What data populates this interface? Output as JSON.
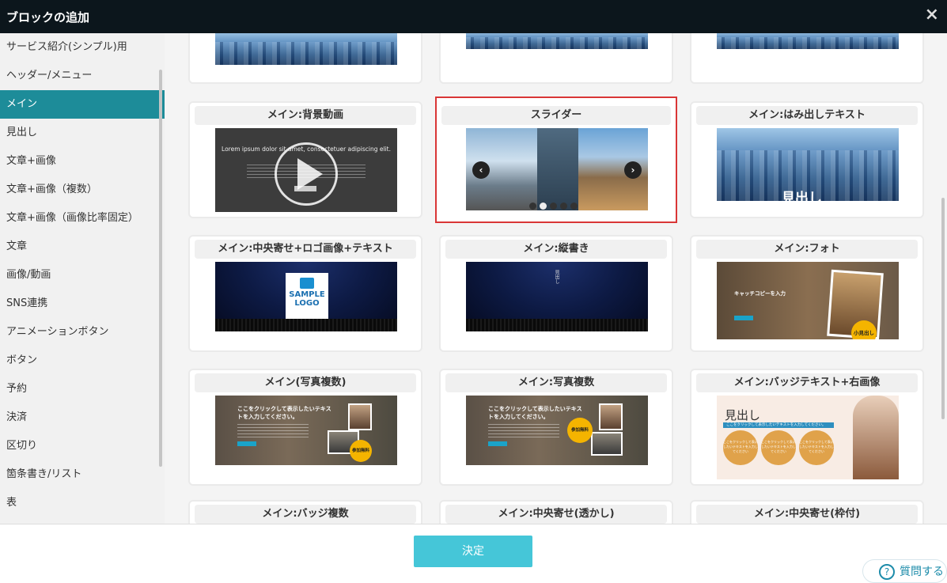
{
  "dialog": {
    "title": "ブロックの追加",
    "close_icon": "×"
  },
  "sidebar": {
    "items": [
      {
        "label": "サービス紹介(シンプル)用"
      },
      {
        "label": "ヘッダー/メニュー"
      },
      {
        "label": "メイン",
        "active": true
      },
      {
        "label": "見出し"
      },
      {
        "label": "文章+画像"
      },
      {
        "label": "文章+画像（複数）"
      },
      {
        "label": "文章+画像（画像比率固定）"
      },
      {
        "label": "文章"
      },
      {
        "label": "画像/動画"
      },
      {
        "label": "SNS連携"
      },
      {
        "label": "アニメーションボタン"
      },
      {
        "label": "ボタン"
      },
      {
        "label": "予約"
      },
      {
        "label": "決済"
      },
      {
        "label": "区切り"
      },
      {
        "label": "箇条書き/リスト"
      },
      {
        "label": "表"
      }
    ]
  },
  "cards": {
    "video": {
      "label": "メイン:背景動画",
      "lorem": "Lorem ipsum dolor sit amet, consectetuer adipiscing elit."
    },
    "slider": {
      "label": "スライダー",
      "prev": "‹",
      "next": "›",
      "slides": 5,
      "current": 2
    },
    "overhang": {
      "label": "メイン:はみ出しテキスト",
      "overlay": "見出し"
    },
    "center_logo": {
      "label": "メイン:中央寄せ+ロゴ画像+テキスト",
      "logo_line1": "SAMPLE",
      "logo_line2": "LOGO"
    },
    "vertical": {
      "label": "メイン:縦書き",
      "vtext": "見出し"
    },
    "photo": {
      "label": "メイン:フォト",
      "copy": "キャッチコピーを入力",
      "badge": "小見出し"
    },
    "multi1": {
      "label": "メイン(写真複数)",
      "heading": "ここをクリックして表示したいテキストを入力してください。",
      "badge": "参加無料"
    },
    "multi2": {
      "label": "メイン:写真複数",
      "heading": "ここをクリックして表示したいテキストを入力してください。",
      "badge": "参加無料"
    },
    "badge_text": {
      "label": "メイン:バッジテキスト+右画像",
      "heading": "見出し",
      "bar": "ここをクリックして表示したいテキストを入力してください。",
      "circle": "ここをクリックして表示したいテキストを入力してください"
    },
    "badge_multi": {
      "label": "メイン:バッジ複数"
    },
    "center_watermark": {
      "label": "メイン:中央寄せ(透かし)"
    },
    "center_framed": {
      "label": "メイン:中央寄せ(枠付)"
    }
  },
  "footer": {
    "decide_label": "決定",
    "help_label": "質問する",
    "help_icon": "?"
  },
  "colors": {
    "titlebar": "#0c161c",
    "active": "#1d8c99",
    "decide": "#45c6d8",
    "selected_border": "#d93636"
  }
}
